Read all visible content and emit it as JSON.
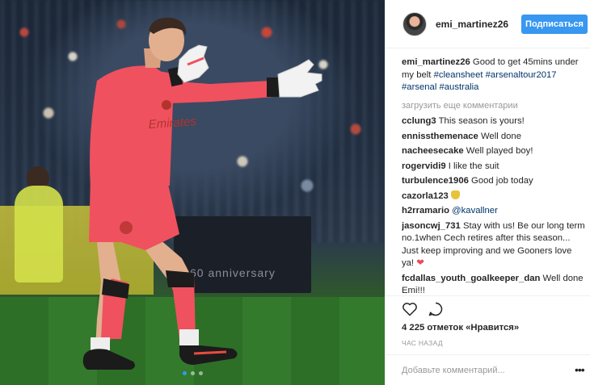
{
  "photo": {
    "banner_text": "60 anniversary",
    "shirt_text": "Emirates",
    "carousel_count": 3,
    "carousel_active": 0
  },
  "header": {
    "username": "emi_martinez26",
    "follow_label": "Подписаться"
  },
  "caption": {
    "username": "emi_martinez26",
    "text": "Good to get 45mins under my belt",
    "hashtags": [
      "#cleansheet",
      "#arsenaltour2017",
      "#arsenal",
      "#australia"
    ]
  },
  "load_more": "загрузить еще комментарии",
  "comments": [
    {
      "user": "cclung3",
      "text": "This season is yours!"
    },
    {
      "user": "ennissthemenace",
      "text": "Well done"
    },
    {
      "user": "nacheesecake",
      "text": "Well played boy!"
    },
    {
      "user": "rogervidi9",
      "text": "I like the suit"
    },
    {
      "user": "turbulence1906",
      "text": "Good job today"
    },
    {
      "user": "cazorla123",
      "text": ""
    },
    {
      "user": "h2rramario",
      "mention": "@kavallner",
      "text": ""
    },
    {
      "user": "jasoncwj_731",
      "text": "Stay with us! Be our long term no.1when Cech retires after this season... Just keep improving and we Gooners love ya!"
    },
    {
      "user": "fcdallas_youth_goalkeeper_dan",
      "text": "Well done Emi!!!"
    }
  ],
  "likes": "4 225 отметок «Нравится»",
  "time": "ЧАС НАЗАД",
  "add_comment_placeholder": "Добавьте комментарий...",
  "more_label": "•••",
  "colors": {
    "accent": "#3897f0",
    "link": "#003569",
    "muted": "#999999",
    "heart": "#ed4956",
    "kit": "#f0515e"
  },
  "icons": [
    "heart-outline-icon",
    "comment-bubble-icon",
    "more-dots-icon"
  ]
}
